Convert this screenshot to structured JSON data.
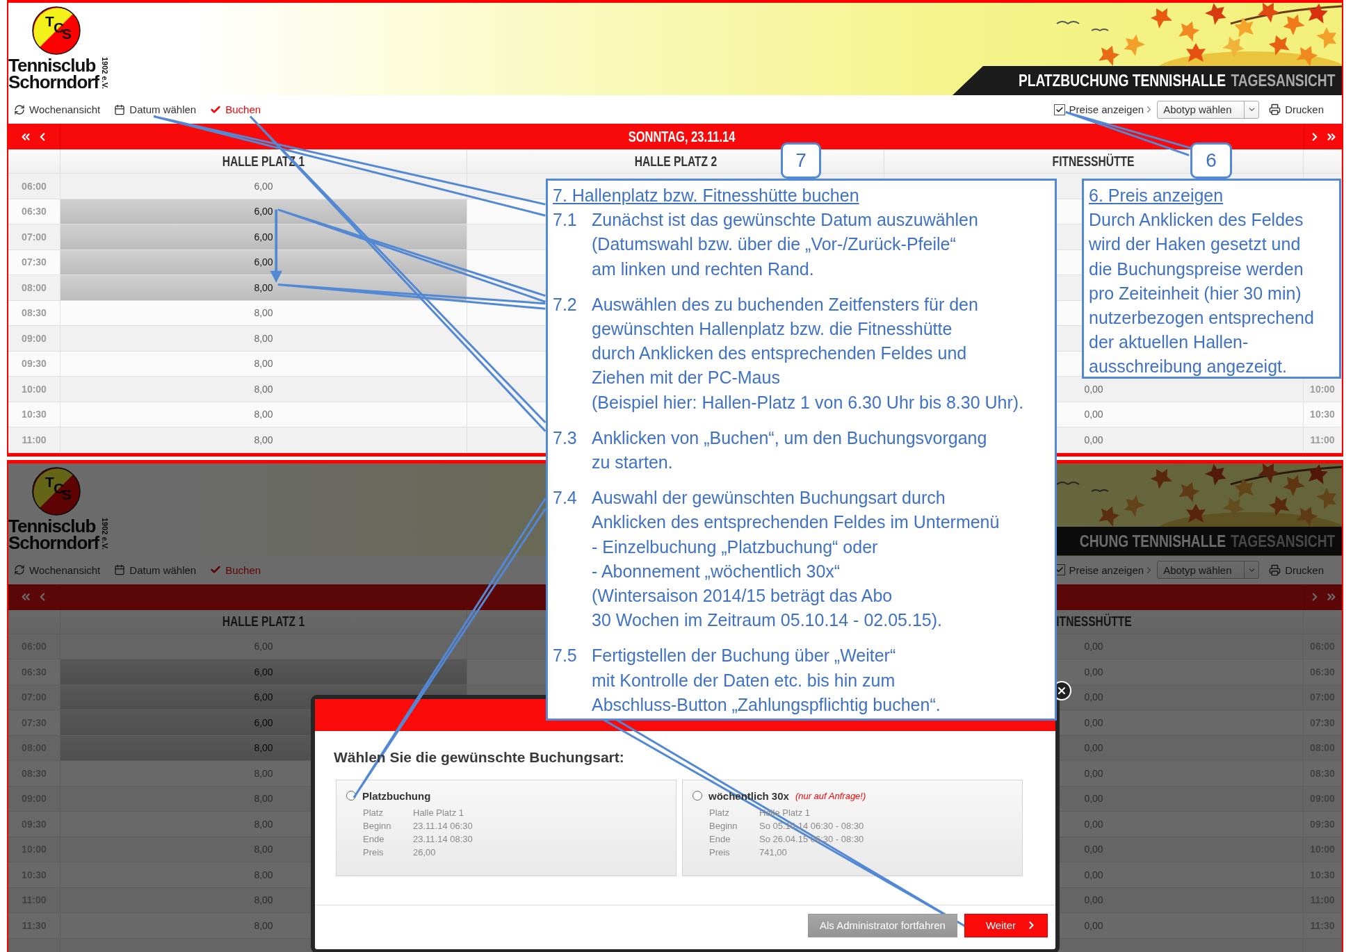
{
  "screens": [
    {
      "logo": {
        "letters": [
          "T",
          "C",
          "S"
        ],
        "lines": [
          "Tennisclub",
          "Schorndorf"
        ],
        "founded": "1902 e.V."
      },
      "banner": {
        "title": "PLATZBUCHUNG TENNISHALLE",
        "subtitle": "TAGESANSICHT"
      },
      "toolbar": {
        "actions": [
          {
            "kind": "refresh",
            "label": "Wochenansicht"
          },
          {
            "kind": "calendar",
            "label": "Datum wählen"
          },
          {
            "kind": "book",
            "label": "Buchen"
          }
        ],
        "price_toggle": {
          "label": "Preise anzeigen",
          "checked": true
        },
        "subscription_select": {
          "value": "Abotyp wählen"
        },
        "print": {
          "label": "Drucken"
        }
      },
      "date_bar": {
        "date": "SONNTAG, 23.11.14"
      },
      "columns": {
        "platz_1": "HALLE PLATZ 1",
        "platz_2": "HALLE PLATZ 2",
        "fitness": "FITNESSHÜTTE"
      },
      "rows": [
        {
          "time": "06:00",
          "platz_1": "6,00",
          "selected": false
        },
        {
          "time": "06:30",
          "platz_1": "6,00",
          "selected": true
        },
        {
          "time": "07:00",
          "platz_1": "6,00",
          "selected": true
        },
        {
          "time": "07:30",
          "platz_1": "6,00",
          "selected": true
        },
        {
          "time": "08:00",
          "platz_1": "8,00",
          "selected": true
        },
        {
          "time": "08:30",
          "platz_1": "8,00",
          "selected": false
        },
        {
          "time": "09:00",
          "platz_1": "8,00",
          "selected": false
        },
        {
          "time": "09:30",
          "platz_1": "8,00",
          "selected": false
        },
        {
          "time": "10:00",
          "platz_1": "8,00",
          "selected": false,
          "fitness": "0,00",
          "time_right": "10:00"
        },
        {
          "time": "10:30",
          "platz_1": "8,00",
          "selected": false,
          "fitness": "0,00",
          "time_right": "10:30"
        },
        {
          "time": "11:00",
          "platz_1": "8,00",
          "selected": false,
          "fitness": "0,00",
          "time_right": "11:00"
        }
      ]
    },
    {
      "logo": {
        "letters": [
          "T",
          "C",
          "S"
        ],
        "lines": [
          "Tennisclub",
          "Schorndorf"
        ],
        "founded": "1902 e.V."
      },
      "banner": {
        "title": "CHUNG TENNISHALLE",
        "subtitle": "TAGESANSICHT"
      },
      "toolbar": {
        "actions": [
          {
            "kind": "refresh",
            "label": "Wochenansicht"
          },
          {
            "kind": "calendar",
            "label": "Datum wählen"
          },
          {
            "kind": "book",
            "label": "Buchen"
          }
        ],
        "price_toggle": {
          "label": "Preise anzeigen",
          "checked": true
        },
        "subscription_select": {
          "value": "Abotyp wählen"
        },
        "print": {
          "label": "Drucken"
        }
      },
      "columns": {
        "platz_1": "HALLE PLATZ 1",
        "fitness": "ITNESSHÜTTE"
      },
      "rows": [
        {
          "time": "06:00",
          "platz_1": "6,00",
          "selected": false,
          "fitness": "0,00",
          "time_right": "06:00"
        },
        {
          "time": "06:30",
          "platz_1": "6,00",
          "selected": true,
          "fitness": "0,00",
          "time_right": "06:30"
        },
        {
          "time": "07:00",
          "platz_1": "6,00",
          "selected": true,
          "fitness": "0,00",
          "time_right": "07:00"
        },
        {
          "time": "07:30",
          "platz_1": "6,00",
          "selected": true,
          "fitness": "0,00",
          "time_right": "07:30"
        },
        {
          "time": "08:00",
          "platz_1": "8,00",
          "selected": true,
          "fitness": "0,00",
          "time_right": "08:00"
        },
        {
          "time": "08:30",
          "platz_1": "8,00",
          "selected": false,
          "fitness": "0,00",
          "time_right": "08:30"
        },
        {
          "time": "09:00",
          "platz_1": "8,00",
          "selected": false,
          "fitness": "0,00",
          "time_right": "09:00"
        },
        {
          "time": "09:30",
          "platz_1": "8,00",
          "selected": false,
          "fitness": "0,00",
          "time_right": "09:30"
        },
        {
          "time": "10:00",
          "platz_1": "8,00",
          "selected": false,
          "fitness": "0,00",
          "time_right": "10:00"
        },
        {
          "time": "10:30",
          "platz_1": "8,00",
          "selected": false,
          "fitness": "0,00",
          "time_right": "10:30"
        },
        {
          "time": "11:00",
          "platz_1": "8,00",
          "selected": false,
          "fitness": "0,00",
          "time_right": "11:00"
        },
        {
          "time": "11:30",
          "platz_1": "8,00",
          "selected": false,
          "fitness": "0,00",
          "time_right": "11:30"
        }
      ],
      "modal": {
        "title": "Wählen Sie die gewünschte Buchungsart:",
        "options": [
          {
            "label": "Platzbuchung",
            "selected": false,
            "details": [
              {
                "key": "Platz",
                "value": "Halle Platz 1"
              },
              {
                "key": "Beginn",
                "value": "23.11.14 06:30"
              },
              {
                "key": "Ende",
                "value": "23.11.14 08:30"
              },
              {
                "key": "Preis",
                "value": "26,00"
              }
            ]
          },
          {
            "label": "wöchentlich 30x",
            "note": "(nur auf Anfrage!)",
            "selected": false,
            "details": [
              {
                "key": "Platz",
                "value": "Halle Platz 1"
              },
              {
                "key": "Beginn",
                "value": "So 05.10.14 06:30 - 08:30"
              },
              {
                "key": "Ende",
                "value": "So 26.04.15 06:30 - 08:30"
              },
              {
                "key": "Preis",
                "value": "741,00"
              }
            ]
          }
        ],
        "buttons": [
          {
            "kind": "plain",
            "label": "Als Administrator fortfahren",
            "disabled": true
          },
          {
            "kind": "next",
            "label": "Weiter",
            "disabled": false
          }
        ]
      }
    }
  ],
  "callouts": [
    {
      "kind": "steps",
      "tag": "7",
      "heading": "7. Hallenplatz bzw. Fitnesshütte buchen",
      "items": [
        {
          "number": "7.1",
          "lines": [
            "Zunächst ist das gewünschte Datum auszuwählen",
            "(Datumswahl bzw. über die „Vor-/Zurück-Pfeile“",
            "am linken und rechten Rand."
          ]
        },
        {
          "number": "7.2",
          "lines": [
            "Auswählen des zu buchenden Zeitfensters für den",
            "gewünschten Hallenplatz bzw. die Fitnesshütte",
            "durch Anklicken des entsprechenden Feldes und",
            "Ziehen mit der PC-Maus",
            "(Beispiel hier: Hallen-Platz 1 von 6.30 Uhr bis 8.30 Uhr)."
          ]
        },
        {
          "number": "7.3",
          "lines": [
            "Anklicken  von „Buchen“, um den Buchungsvorgang",
            "zu starten."
          ]
        },
        {
          "number": "7.4",
          "lines": [
            "Auswahl der gewünschten Buchungsart durch",
            "Anklicken des entsprechenden Feldes im Untermenü",
            "- Einzelbuchung „Platzbuchung“ oder",
            "- Abonnement „wöchentlich 30x“",
            "(Wintersaison 2014/15 beträgt das Abo",
            "30 Wochen im Zeitraum 05.10.14 - 02.05.15)."
          ]
        },
        {
          "number": "7.5",
          "lines": [
            "Fertigstellen der Buchung über „Weiter“",
            "mit Kontrolle der Daten etc. bis hin zum",
            "Abschluss-Button „Zahlungspflichtig buchen“."
          ]
        }
      ]
    },
    {
      "kind": "note",
      "tag": "6",
      "heading": "6. Preis anzeigen",
      "lines": [
        "Durch Anklicken des Feldes",
        "wird der Haken gesetzt und",
        "die Buchungspreise werden",
        "pro Zeiteinheit (hier 30 min)",
        "nutzerbezogen entsprechend",
        "der aktuellen Hallen-",
        "ausschreibung angezeigt."
      ]
    }
  ]
}
